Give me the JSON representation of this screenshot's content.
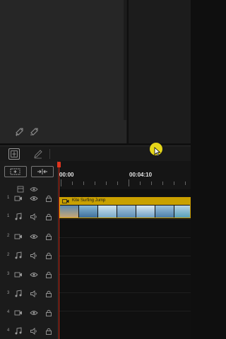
{
  "media_panel": {
    "tag_buttons": [
      "tag-add-icon",
      "tag-remove-icon"
    ]
  },
  "toolbar": {
    "tools": [
      "track-layout-icon",
      "pencil-icon"
    ]
  },
  "timeline": {
    "header_buttons": [
      "add-track-icon",
      "fit-zoom-icon"
    ],
    "timecodes": [
      "00:00",
      "00:04:10"
    ],
    "tracks": [
      {
        "num": "1",
        "type": "video"
      },
      {
        "num": "1",
        "type": "audio"
      },
      {
        "num": "2",
        "type": "video"
      },
      {
        "num": "2",
        "type": "audio"
      },
      {
        "num": "3",
        "type": "video"
      },
      {
        "num": "3",
        "type": "audio"
      },
      {
        "num": "4",
        "type": "video"
      },
      {
        "num": "4",
        "type": "audio"
      }
    ],
    "clip": {
      "title": "Kite Surfing Jump",
      "color": "#c9a100"
    },
    "playhead_color": "#d7311d"
  },
  "colors": {
    "cursor_highlight": "#e5d61a"
  }
}
